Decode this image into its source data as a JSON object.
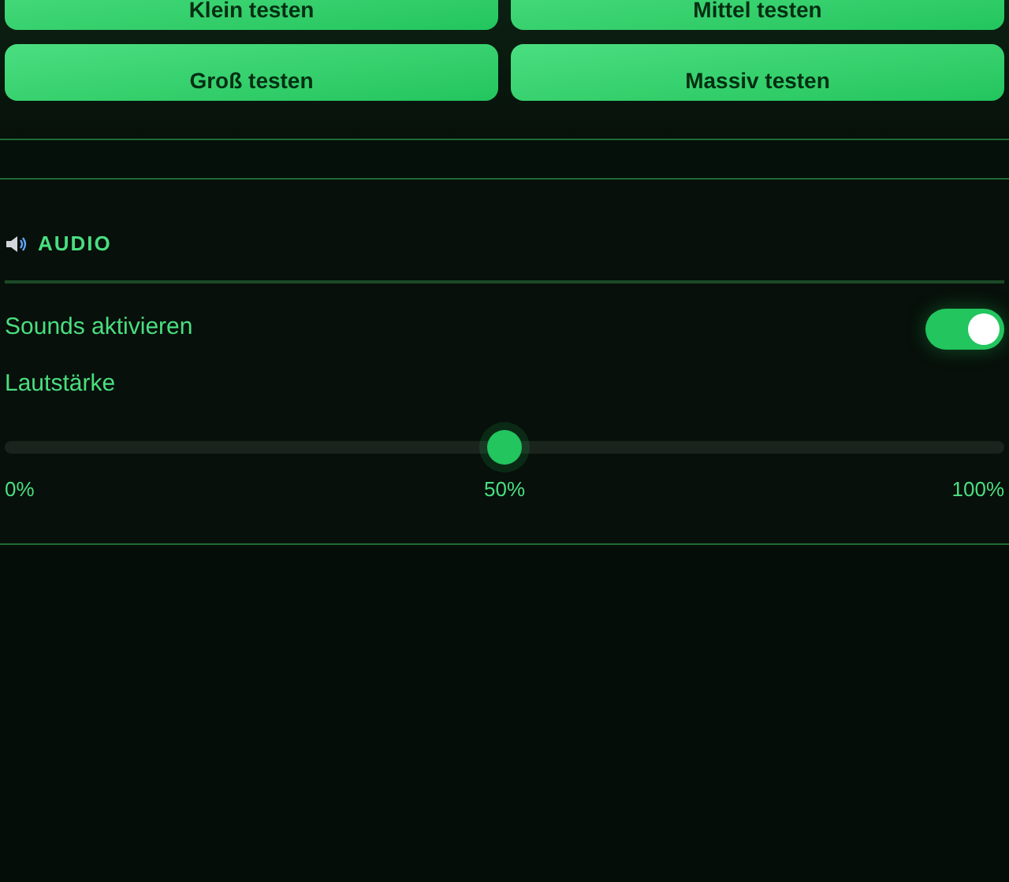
{
  "test_buttons": [
    {
      "label": "Klein testen"
    },
    {
      "label": "Mittel testen"
    },
    {
      "label": "Groß testen"
    },
    {
      "label": "Massiv testen"
    }
  ],
  "audio": {
    "title": "AUDIO",
    "sounds": {
      "label": "Sounds aktivieren",
      "on": true
    },
    "volume": {
      "label": "Lautstärke",
      "level": 0.5,
      "min_label": "0%",
      "mid_label": "50%",
      "max_label": "100%"
    }
  }
}
